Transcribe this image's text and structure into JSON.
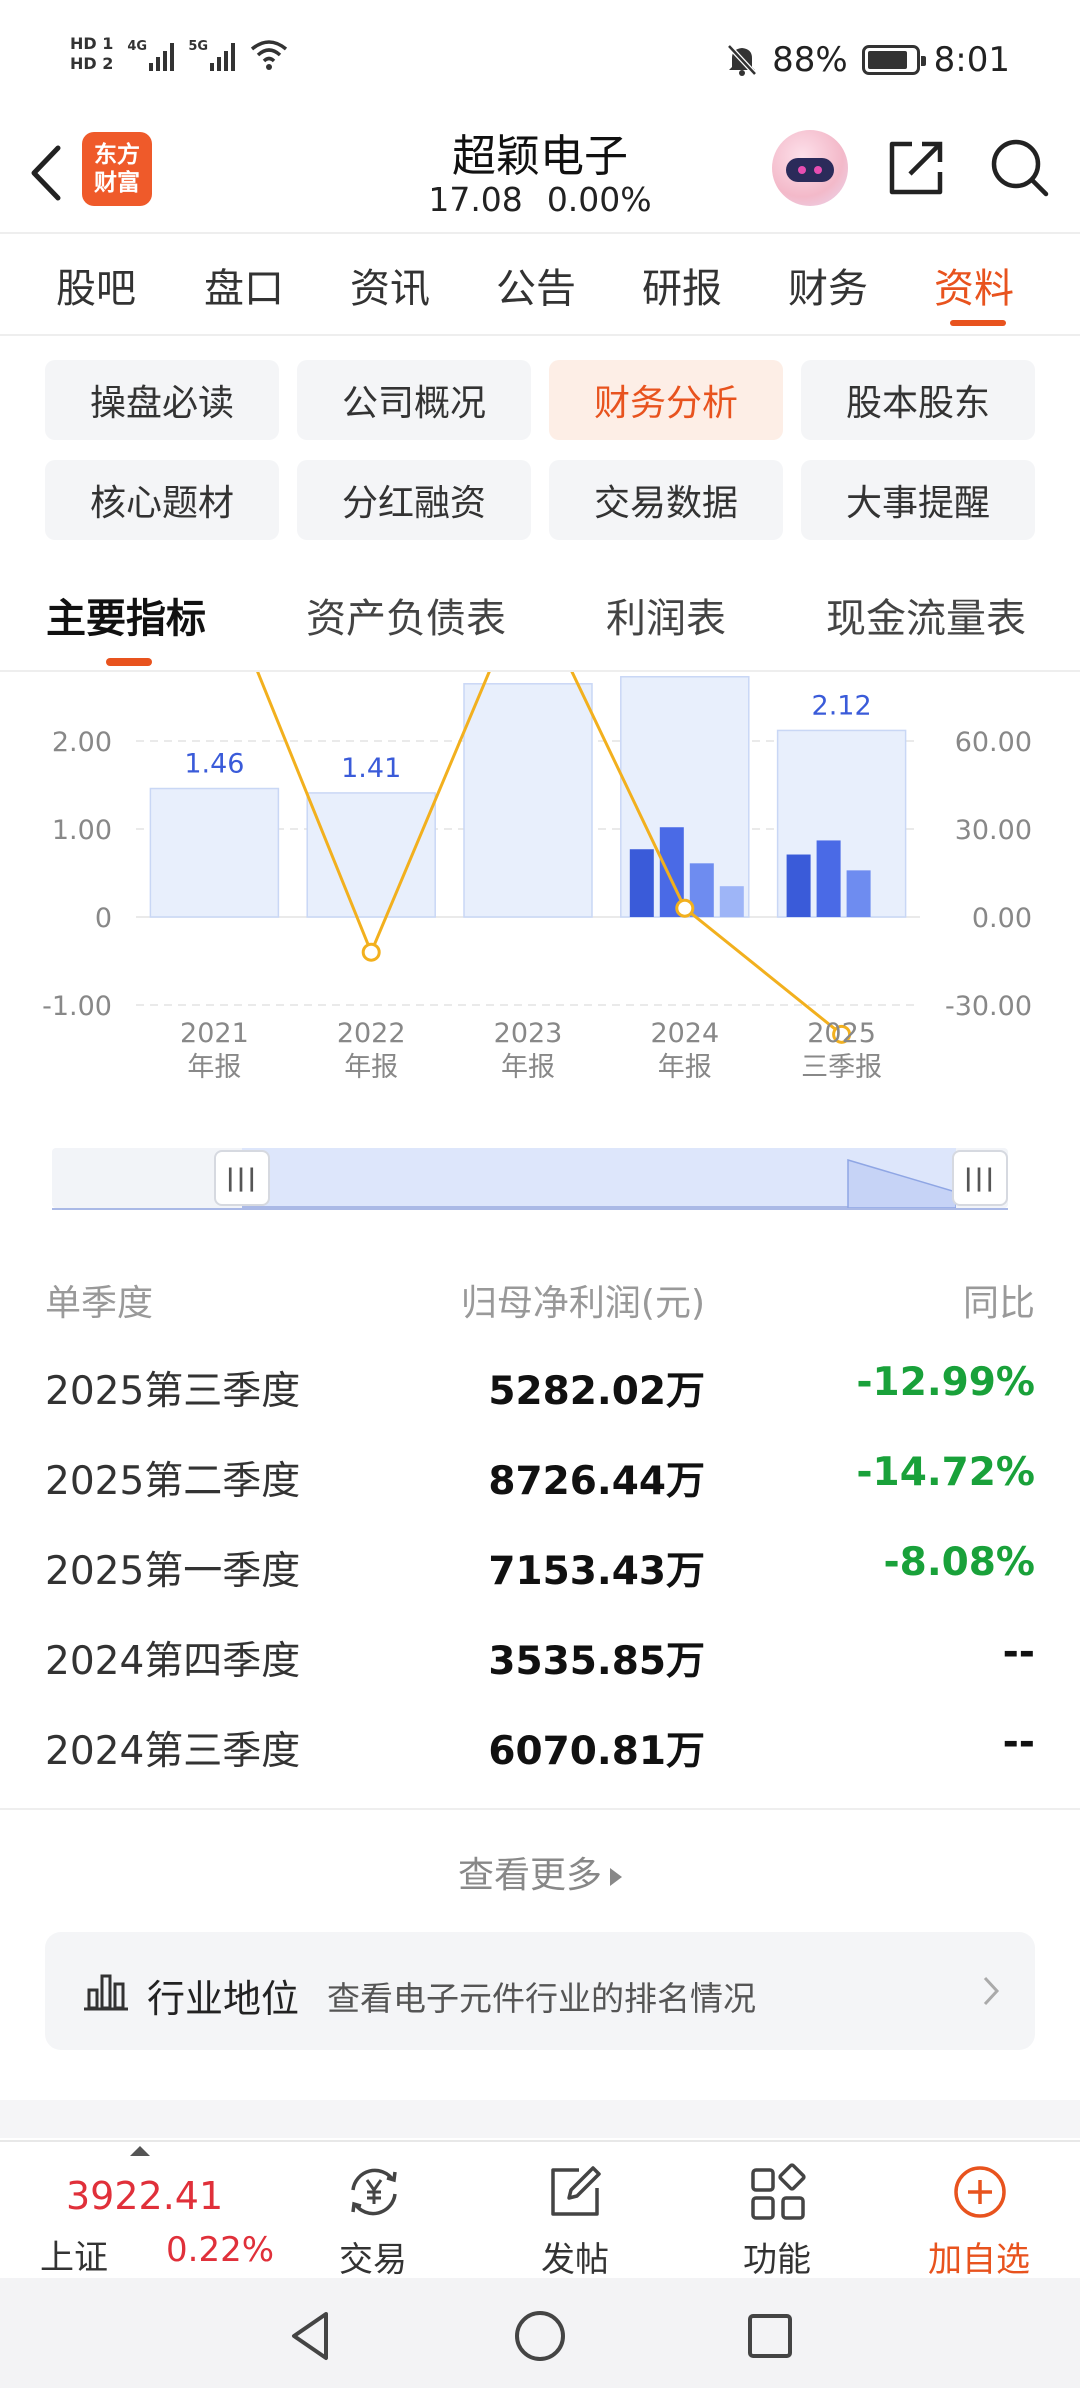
{
  "status_bar": {
    "hd1": "HD 1",
    "hd2": "HD 2",
    "net1": "4G",
    "net2": "5G",
    "battery_percent": "88%",
    "time": "8:01"
  },
  "header": {
    "logo_line1": "东方",
    "logo_line2": "财富",
    "stock_name": "超颖电子",
    "price": "17.08",
    "change": "0.00%"
  },
  "main_tabs": [
    {
      "label": "股吧"
    },
    {
      "label": "盘口"
    },
    {
      "label": "资讯"
    },
    {
      "label": "公告"
    },
    {
      "label": "研报"
    },
    {
      "label": "财务"
    },
    {
      "label": "资料",
      "active": true
    }
  ],
  "sub_menu": [
    {
      "label": "操盘必读"
    },
    {
      "label": "公司概况"
    },
    {
      "label": "财务分析",
      "active": true
    },
    {
      "label": "股本股东"
    },
    {
      "label": "核心题材"
    },
    {
      "label": "分红融资"
    },
    {
      "label": "交易数据"
    },
    {
      "label": "大事提醒"
    }
  ],
  "section_tabs": [
    {
      "label": "主要指标",
      "active": true
    },
    {
      "label": "资产负债表"
    },
    {
      "label": "利润表"
    },
    {
      "label": "现金流量表"
    }
  ],
  "chart_data": {
    "type": "bar",
    "categories": [
      "2021\n年报",
      "2022\n年报",
      "2023\n年报",
      "2024\n年报",
      "2025\n三季报"
    ],
    "category_lines": [
      [
        "2021",
        "年报"
      ],
      [
        "2022",
        "年报"
      ],
      [
        "2023",
        "年报"
      ],
      [
        "2024",
        "年报"
      ],
      [
        "2025",
        "三季报"
      ]
    ],
    "annual_values": [
      1.46,
      1.41,
      2.65,
      2.73,
      2.12
    ],
    "annual_labels": [
      "1.46",
      "1.41",
      "",
      "",
      "2.12"
    ],
    "quarterly_values": [
      [],
      [],
      [],
      [
        0.77,
        1.02,
        0.61,
        0.35
      ],
      [
        0.71,
        0.87,
        0.53
      ]
    ],
    "line_values": [
      120,
      -12,
      115,
      3,
      -40
    ],
    "left_ylim": [
      -1.0,
      3.0
    ],
    "right_ylim": [
      -30.0,
      90.0
    ],
    "left_ticks": [
      "2.00",
      "1.00",
      "0",
      "-1.00"
    ],
    "left_tick_values": [
      2,
      1,
      0,
      -1
    ],
    "right_ticks": [
      "60.00",
      "30.00",
      "0.00",
      "-30.00"
    ],
    "right_tick_values": [
      60,
      30,
      0,
      -30
    ],
    "grid": true,
    "colors": {
      "annual_bar": "#e8effc",
      "annual_border": "#c9d7f5",
      "q1": "#3a5bd9",
      "q2": "#4a6ae6",
      "q3": "#6e8cf0",
      "q4": "#9eb5f7",
      "line": "#f2b01e",
      "label": "#3a5bd9"
    }
  },
  "slider": {
    "handle_left": "|||",
    "handle_right": "|||"
  },
  "table": {
    "headers": [
      "单季度",
      "归母净利润(元)",
      "同比"
    ],
    "rows": [
      {
        "period": "2025第三季度",
        "profit": "5282.02万",
        "yoy": "-12.99%",
        "tone": "green"
      },
      {
        "period": "2025第二季度",
        "profit": "8726.44万",
        "yoy": "-14.72%",
        "tone": "green"
      },
      {
        "period": "2025第一季度",
        "profit": "7153.43万",
        "yoy": "-8.08%",
        "tone": "green"
      },
      {
        "period": "2024第四季度",
        "profit": "3535.85万",
        "yoy": "--",
        "tone": "dark"
      },
      {
        "period": "2024第三季度",
        "profit": "6070.81万",
        "yoy": "--",
        "tone": "dark"
      }
    ]
  },
  "more_link": "查看更多",
  "industry": {
    "title": "行业地位",
    "desc": "查看电子元件行业的排名情况"
  },
  "bottom_nav": {
    "index_value": "3922.41",
    "index_name": "上证",
    "index_change": "0.22%",
    "items": [
      {
        "label": "交易",
        "icon": "yuan-refresh-icon"
      },
      {
        "label": "发帖",
        "icon": "edit-icon"
      },
      {
        "label": "功能",
        "icon": "grid-icon"
      },
      {
        "label": "加自选",
        "icon": "plus-circle-icon"
      }
    ]
  }
}
